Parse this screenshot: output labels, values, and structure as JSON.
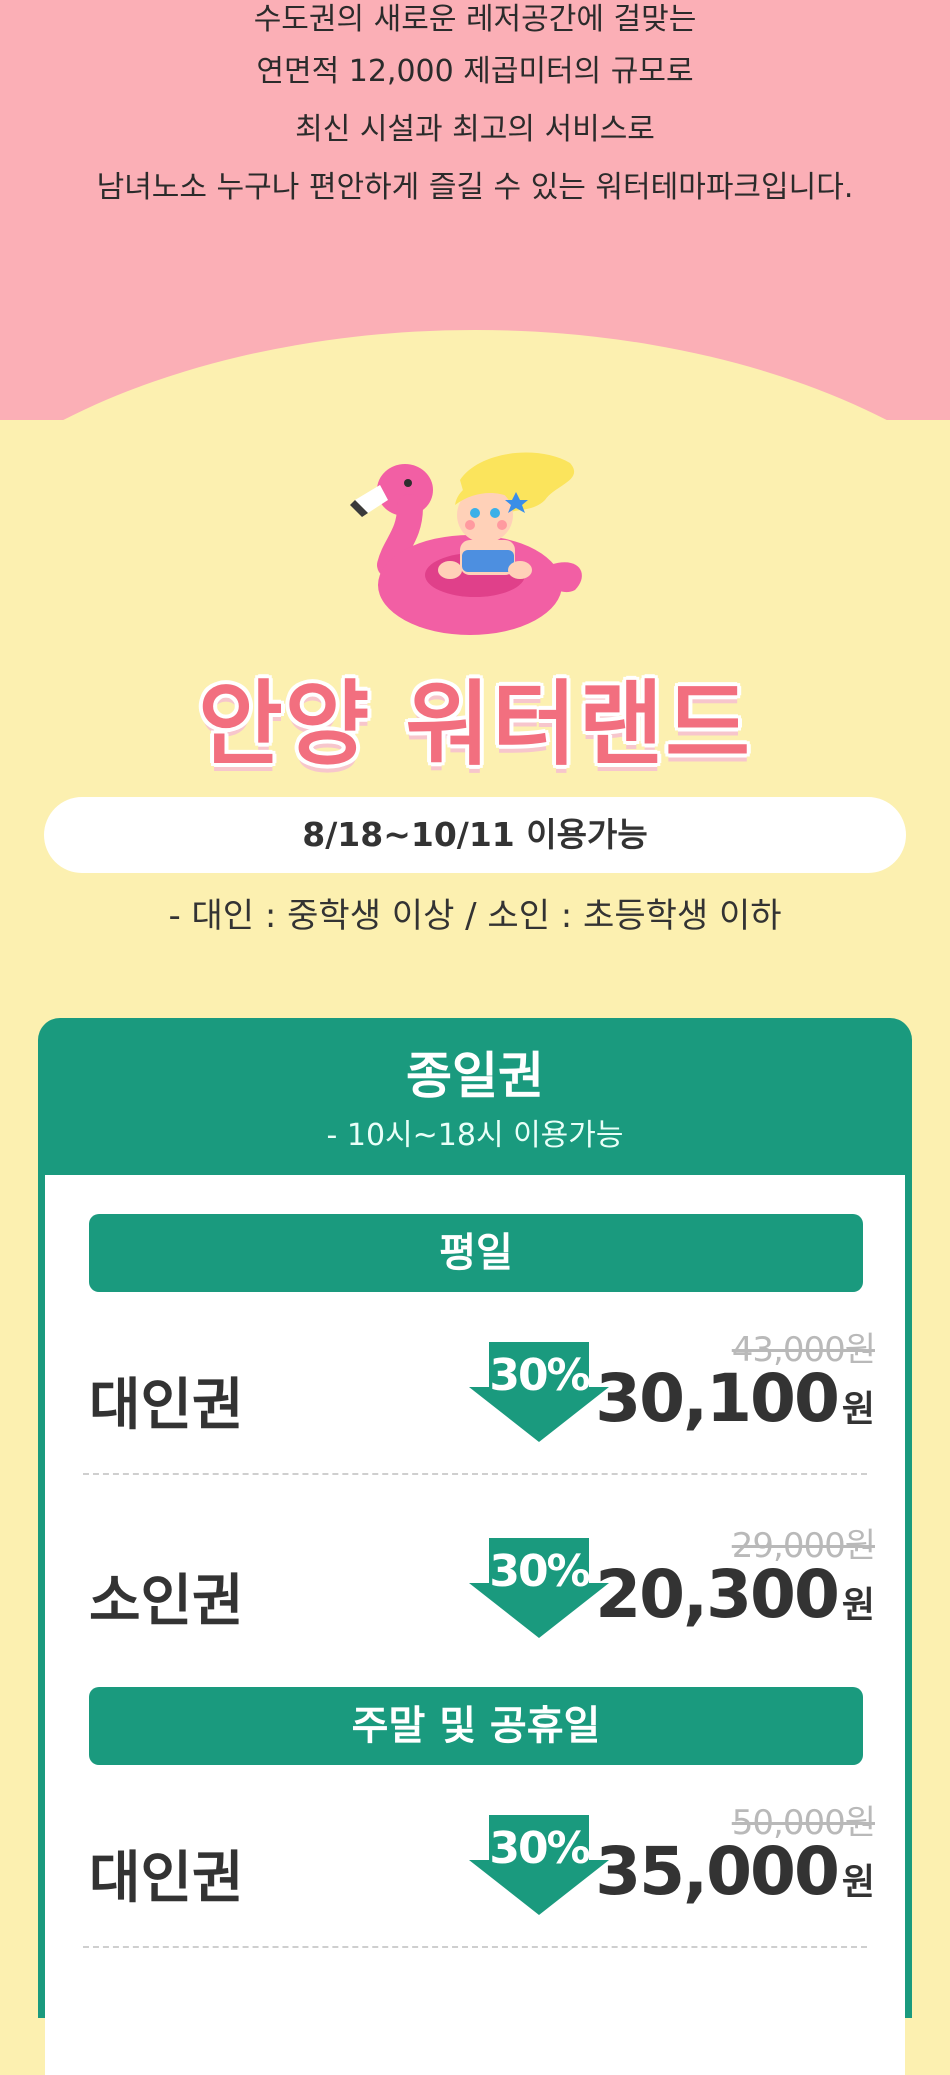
{
  "intro": {
    "lines": [
      "수도권의 새로운 레저공간에 걸맞는",
      "연면적 12,000 제곱미터의 규모로",
      "최신 시설과 최고의 서비스로",
      "남녀노소 누구나 편안하게 즐길 수 있는 워터테마파크입니다."
    ]
  },
  "brand": {
    "title": "안양 워터랜드"
  },
  "period": "8/18~10/11 이용가능",
  "age_note": "- 대인 : 중학생 이상 / 소인 : 초등학생 이하",
  "ticket": {
    "title": "종일권",
    "subtitle": "- 10시~18시 이용가능",
    "weekday": {
      "header": "평일",
      "rows": [
        {
          "label": "대인권",
          "discount": "30%",
          "original": "43,000원",
          "price": "30,100",
          "unit": "원"
        },
        {
          "label": "소인권",
          "discount": "30%",
          "original": "29,000원",
          "price": "20,300",
          "unit": "원"
        }
      ]
    },
    "weekend": {
      "header": "주말 및 공휴일",
      "rows": [
        {
          "label": "대인권",
          "discount": "30%",
          "original": "50,000원",
          "price": "35,000",
          "unit": "원"
        }
      ]
    }
  },
  "colors": {
    "pink_bg": "#fbafb6",
    "yellow_bg": "#fcf0b0",
    "green": "#1a9a7e",
    "brand_pink": "#f26f7f"
  }
}
